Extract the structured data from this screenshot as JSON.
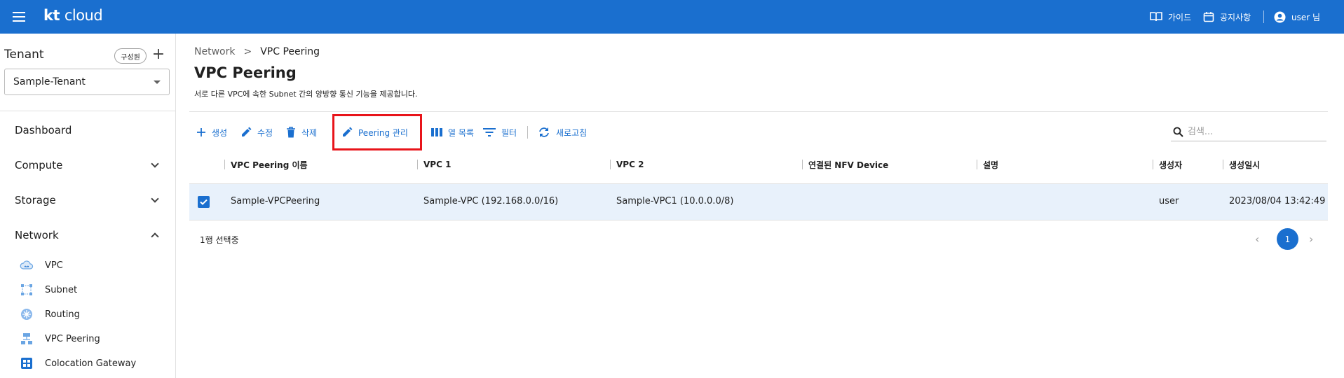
{
  "topbar": {
    "logo_kt": "kt",
    "logo_cloud": "cloud",
    "guide_label": "가이드",
    "notice_label": "공지사항",
    "user_label": "user 님",
    "brand_color": "#1a6fcf"
  },
  "sidebar": {
    "tenant_title": "Tenant",
    "member_button": "구성원",
    "add_icon": "+",
    "tenant_selected": "Sample-Tenant",
    "menu": {
      "dashboard": "Dashboard",
      "compute": "Compute",
      "storage": "Storage",
      "network": "Network"
    },
    "network_items": [
      "VPC",
      "Subnet",
      "Routing",
      "VPC Peering",
      "Colocation Gateway"
    ]
  },
  "breadcrumb": {
    "parent": "Network",
    "separator": ">",
    "current": "VPC Peering"
  },
  "page": {
    "title": "VPC Peering",
    "description": "서로 다른 VPC에 속한 Subnet 간의 양방향 통신 기능을 제공합니다."
  },
  "toolbar": {
    "create": "생성",
    "edit": "수정",
    "delete": "삭제",
    "peering_manage": "Peering 관리",
    "columns": "열 목록",
    "filter": "필터",
    "refresh": "새로고침",
    "search_placeholder": "검색..."
  },
  "table": {
    "headers": [
      "VPC Peering 이름",
      "VPC 1",
      "VPC 2",
      "연결된 NFV Device",
      "설명",
      "생성자",
      "생성일시"
    ],
    "rows": [
      {
        "checked": true,
        "name": "Sample-VPCPeering",
        "vpc1": "Sample-VPC (192.168.0.0/16)",
        "vpc2": "Sample-VPC1 (10.0.0.0/8)",
        "nfv": "",
        "desc": "",
        "creator": "user",
        "created_at": "2023/08/04 13:42:49"
      }
    ]
  },
  "footer": {
    "selected_count": "1행 선택중",
    "current_page": "1",
    "prev": "‹",
    "next": "›"
  }
}
